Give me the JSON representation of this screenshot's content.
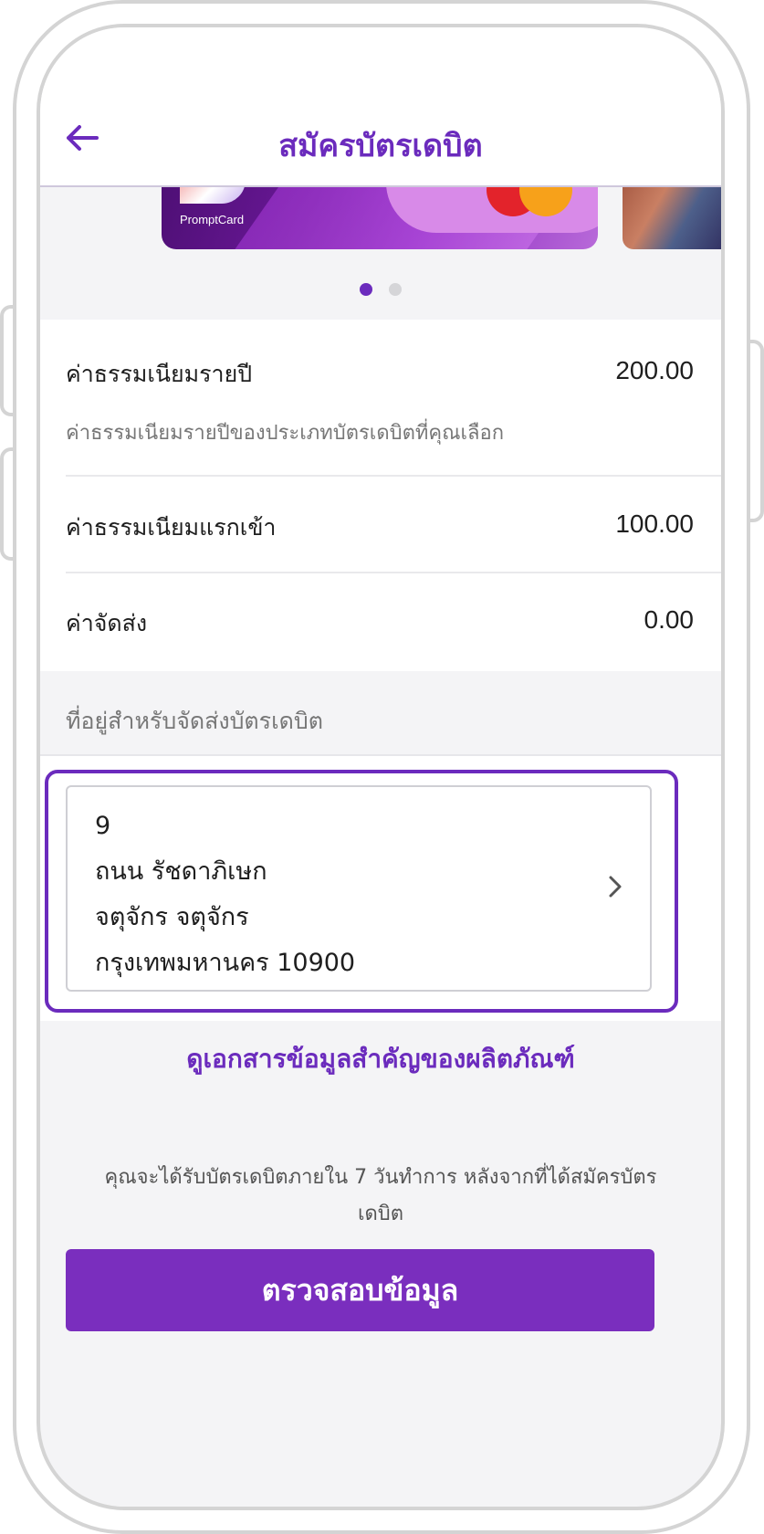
{
  "header": {
    "title": "สมัครบัตรเดบิต",
    "back_icon": "arrow-left-icon"
  },
  "carousel": {
    "card_brand": "PromptCard",
    "dots": [
      {
        "active": true
      },
      {
        "active": false
      }
    ]
  },
  "fees": {
    "annual": {
      "label": "ค่าธรรมเนียมรายปี",
      "value": "200.00",
      "sub": "ค่าธรรมเนียมรายปีของประเภทบัตรเดบิตที่คุณเลือก"
    },
    "entry": {
      "label": "ค่าธรรมเนียมแรกเข้า",
      "value": "100.00"
    },
    "shipping": {
      "label": "ค่าจัดส่ง",
      "value": "0.00"
    }
  },
  "address": {
    "heading": "ที่อยู่สำหรับจัดส่งบัตรเดบิต",
    "lines": [
      "9",
      "ถนน รัชดาภิเษก",
      "จตุจักร จตุจักร",
      "กรุงเทพมหานคร 10900"
    ]
  },
  "doc_link": "ดูเอกสารข้อมูลสำคัญของผลิตภัณฑ์",
  "note": "คุณจะได้รับบัตรเดบิตภายใน 7 วันทำการ หลังจากที่ได้สมัครบัตรเดบิต",
  "cta_label": "ตรวจสอบข้อมูล",
  "colors": {
    "accent": "#6b2bbd",
    "button": "#7a2ebe",
    "background": "#f4f4f6"
  }
}
